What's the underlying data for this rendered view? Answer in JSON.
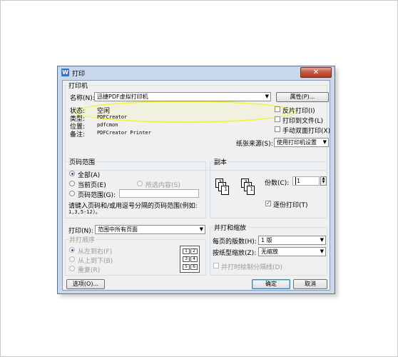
{
  "dialog": {
    "title": "打印",
    "app_icon": "W",
    "close_icon": "✕"
  },
  "printer": {
    "group_title": "打印机",
    "name_label": "名称(N):",
    "name_value": "迅捷PDF虚拟打印机",
    "properties_button": "属性(P)...",
    "status_label": "状态:",
    "status_value": "空闲",
    "type_label": "类型:",
    "type_value": "PDFCreator",
    "location_label": "位置:",
    "location_value": "pdfcmon",
    "comment_label": "备注:",
    "comment_value": "PDFCreator Printer",
    "reverse_print": "反片打印(I)",
    "print_to_file": "打印到文件(L)",
    "manual_duplex": "手动双面打印(X)",
    "paper_source_label": "纸张来源(S):",
    "paper_source_value": "使用打印机设置"
  },
  "page_range": {
    "group_title": "页码范围",
    "all": "全部(A)",
    "current": "当前页(E)",
    "selection": "所选内容(S)",
    "pages": "页码范围(G):",
    "hint_line1": "请键入页码和/或用逗号分隔的页码范围(例如:",
    "hint_line2": "1,3,5-12)。"
  },
  "copies": {
    "group_title": "副本",
    "count_label": "份数(C):",
    "count_value": "1",
    "collate": "逐份打印(T)",
    "sheet_labels": [
      "1",
      "2",
      "3",
      "1",
      "2",
      "3"
    ]
  },
  "print_what": {
    "label": "打印(N):",
    "value": "范围中所有页面",
    "order_title": "并打顺序",
    "left_to_right": "从左到右(F)",
    "top_to_bottom": "从上到下(B)",
    "repeat": "重复(R)",
    "order_labels": [
      "1",
      "2",
      "3",
      "4",
      "5",
      "6"
    ]
  },
  "zoom": {
    "group_title": "并打和缩放",
    "per_sheet_label": "每页的版数(H):",
    "per_sheet_value": "1 版",
    "scale_label": "按纸型缩放(Z):",
    "scale_value": "无缩放",
    "draw_borders": "并打时绘制分隔线(D)"
  },
  "buttons": {
    "options": "选项(O)...",
    "ok": "确定",
    "cancel": "取消"
  },
  "icons": {
    "dropdown": "▼",
    "spin_up": "▲",
    "spin_down": "▼",
    "check": "✓"
  },
  "colors": {
    "highlight": "#f0f34a",
    "titlebar": "#c9d8ea",
    "close": "#c75a45"
  }
}
